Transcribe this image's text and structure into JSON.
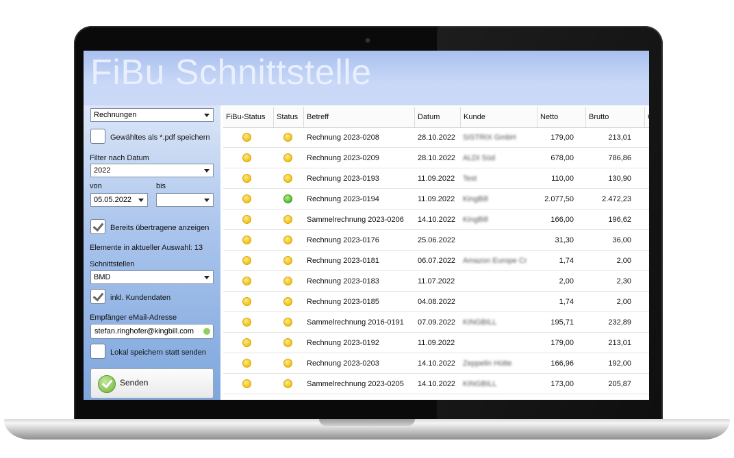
{
  "app": {
    "title": "FiBu Schnittstelle"
  },
  "sidebar": {
    "type_select": "Rechnungen",
    "save_pdf_label": "Gewähltes als *.pdf speichern",
    "filter_label": "Filter nach Datum",
    "year_select": "2022",
    "von_label": "von",
    "bis_label": "bis",
    "von_value": "05.05.2022",
    "bis_value": "",
    "show_transferred_label": "Bereits übertragene anzeigen",
    "show_transferred_checked": true,
    "count_text": "Elemente in aktueller Auswahl: 13",
    "interfaces_label": "Schnittstellen",
    "interface_select": "BMD",
    "incl_customers_label": "inkl. Kundendaten",
    "incl_customers_checked": true,
    "email_label": "Empfänger eMail-Adresse",
    "email_value": "stefan.ringhofer@kingbill.com",
    "local_save_label": "Lokal speichern statt senden",
    "local_save_checked": false,
    "send_label": "Senden"
  },
  "table": {
    "columns": [
      "FiBu-Status",
      "Status",
      "Betreff",
      "Datum",
      "Kunde",
      "Netto",
      "Brutto",
      "G"
    ],
    "rows": [
      {
        "fibu": "yellow",
        "status": "yellow",
        "betreff": "Rechnung 2023-0208",
        "datum": "28.10.2022",
        "kunde": "SISTRIX GmbH",
        "netto": "179,00",
        "brutto": "213,01"
      },
      {
        "fibu": "yellow",
        "status": "yellow",
        "betreff": "Rechnung 2023-0209",
        "datum": "28.10.2022",
        "kunde": "ALDI Süd",
        "netto": "678,00",
        "brutto": "786,86"
      },
      {
        "fibu": "yellow",
        "status": "yellow",
        "betreff": "Rechnung 2023-0193",
        "datum": "11.09.2022",
        "kunde": "Test",
        "netto": "110,00",
        "brutto": "130,90"
      },
      {
        "fibu": "yellow",
        "status": "green",
        "betreff": "Rechnung 2023-0194",
        "datum": "11.09.2022",
        "kunde": "KingBill",
        "netto": "2.077,50",
        "brutto": "2.472,23"
      },
      {
        "fibu": "yellow",
        "status": "yellow",
        "betreff": "Sammelrechnung 2023-0206",
        "datum": "14.10.2022",
        "kunde": "KingBill",
        "netto": "166,00",
        "brutto": "196,62"
      },
      {
        "fibu": "yellow",
        "status": "yellow",
        "betreff": "Rechnung 2023-0176",
        "datum": "25.06.2022",
        "kunde": "",
        "netto": "31,30",
        "brutto": "36,00"
      },
      {
        "fibu": "yellow",
        "status": "yellow",
        "betreff": "Rechnung 2023-0181",
        "datum": "06.07.2022",
        "kunde": "Amazon Europe Cr",
        "netto": "1,74",
        "brutto": "2,00"
      },
      {
        "fibu": "yellow",
        "status": "yellow",
        "betreff": "Rechnung 2023-0183",
        "datum": "11.07.2022",
        "kunde": "",
        "netto": "2,00",
        "brutto": "2,30"
      },
      {
        "fibu": "yellow",
        "status": "yellow",
        "betreff": "Rechnung 2023-0185",
        "datum": "04.08.2022",
        "kunde": "",
        "netto": "1,74",
        "brutto": "2,00"
      },
      {
        "fibu": "yellow",
        "status": "yellow",
        "betreff": "Sammelrechnung 2016-0191",
        "datum": "07.09.2022",
        "kunde": "KINGBILL",
        "netto": "195,71",
        "brutto": "232,89"
      },
      {
        "fibu": "yellow",
        "status": "yellow",
        "betreff": "Rechnung 2023-0192",
        "datum": "11.09.2022",
        "kunde": "",
        "netto": "179,00",
        "brutto": "213,01"
      },
      {
        "fibu": "yellow",
        "status": "yellow",
        "betreff": "Rechnung 2023-0203",
        "datum": "14.10.2022",
        "kunde": "Zeppelin Hütte",
        "netto": "166,96",
        "brutto": "192,00"
      },
      {
        "fibu": "yellow",
        "status": "yellow",
        "betreff": "Sammelrechnung 2023-0205",
        "datum": "14.10.2022",
        "kunde": "KINGBILL",
        "netto": "173,00",
        "brutto": "205,87"
      }
    ]
  },
  "colors": {
    "banner": "#c9d8f7",
    "status_yellow": "#f1c017",
    "status_green": "#55b82b"
  }
}
